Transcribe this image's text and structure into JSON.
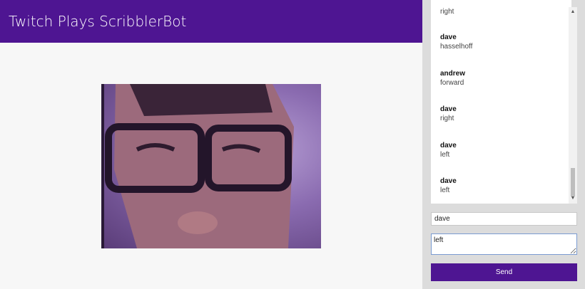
{
  "header": {
    "title": "Twitch Plays ScribblerBot"
  },
  "chat": {
    "messages": [
      {
        "user": "",
        "text": "right"
      },
      {
        "user": "dave",
        "text": "hasselhoff"
      },
      {
        "user": "andrew",
        "text": "forward"
      },
      {
        "user": "dave",
        "text": "right"
      },
      {
        "user": "dave",
        "text": "left"
      },
      {
        "user": "dave",
        "text": "left"
      }
    ]
  },
  "form": {
    "name_value": "dave",
    "message_value": "left",
    "send_label": "Send"
  },
  "colors": {
    "header": "#4e1592",
    "button": "#4e1592"
  },
  "icons": {
    "scroll_up": "scroll-up-arrow-icon",
    "scroll_down": "scroll-down-arrow-icon"
  }
}
